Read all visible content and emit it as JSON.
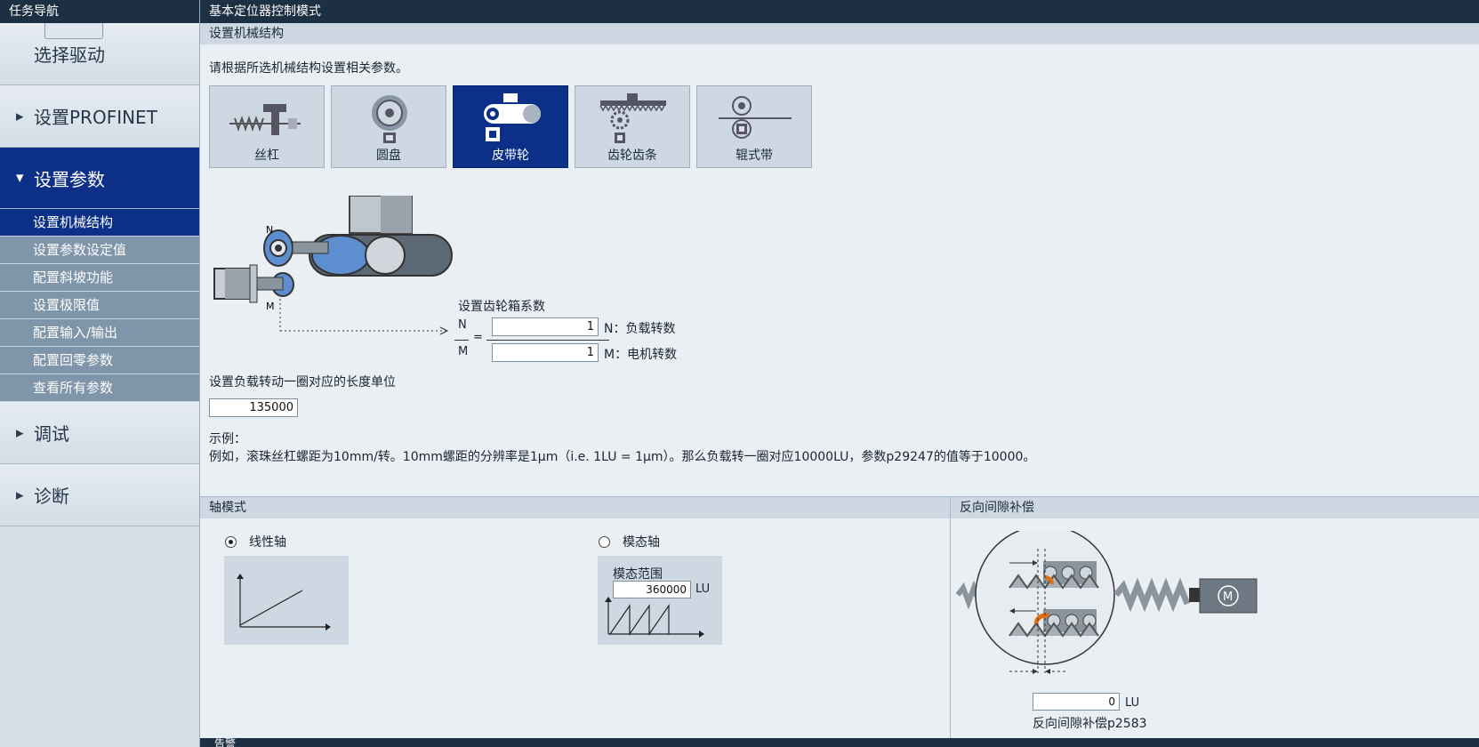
{
  "nav": {
    "header": "任务导航",
    "items": [
      {
        "label": "选择驱动"
      },
      {
        "label": "设置PROFINET"
      },
      {
        "label": "设置参数"
      },
      {
        "label": "调试"
      },
      {
        "label": "诊断"
      }
    ],
    "subitems": [
      {
        "label": "设置机械结构"
      },
      {
        "label": "设置参数设定值"
      },
      {
        "label": "配置斜坡功能"
      },
      {
        "label": "设置极限值"
      },
      {
        "label": "配置输入/输出"
      },
      {
        "label": "配置回零参数"
      },
      {
        "label": "查看所有参数"
      }
    ]
  },
  "main": {
    "title": "基本定位器控制模式",
    "section_title": "设置机械结构",
    "instruction": "请根据所选机械结构设置相关参数。",
    "mechanisms": [
      {
        "label": "丝杠",
        "icon": "ball-screw-icon"
      },
      {
        "label": "圆盘",
        "icon": "rotary-table-icon"
      },
      {
        "label": "皮带轮",
        "icon": "belt-pulley-icon",
        "selected": true
      },
      {
        "label": "齿轮齿条",
        "icon": "rack-pinion-icon"
      },
      {
        "label": "辊式带",
        "icon": "roller-belt-icon"
      }
    ],
    "diagram": {
      "label_n": "N",
      "label_m": "M"
    },
    "gearbox": {
      "title": "设置齿轮箱系数",
      "n_label": "N",
      "m_label": "M",
      "equals": "=",
      "n_value": "1",
      "m_value": "1",
      "n_desc": "N：负载转数",
      "m_desc": "M：电机转数"
    },
    "length_unit": {
      "label": "设置负载转动一圈对应的长度单位",
      "value": "135000"
    },
    "example": {
      "title": "示例：",
      "text": "例如，滚珠丝杠螺距为10mm/转。10mm螺距的分辨率是1μm（i.e. 1LU = 1μm）。那么负载转一圈对应10000LU，参数p29247的值等于10000。"
    }
  },
  "axis_mode": {
    "title": "轴模式",
    "linear_label": "线性轴",
    "modulo_label": "模态轴",
    "selected": "linear",
    "modulo_range_label": "模态范围",
    "modulo_range_value": "360000",
    "unit": "LU"
  },
  "backlash": {
    "title": "反向间隙补偿",
    "value": "0",
    "unit": "LU",
    "caption": "反向间隙补偿p2583",
    "motor_symbol": "M"
  },
  "footer": {
    "label": "告警"
  },
  "colors": {
    "accent": "#0c2f88",
    "header": "#1d2f42",
    "highlight": "#e36c09"
  }
}
